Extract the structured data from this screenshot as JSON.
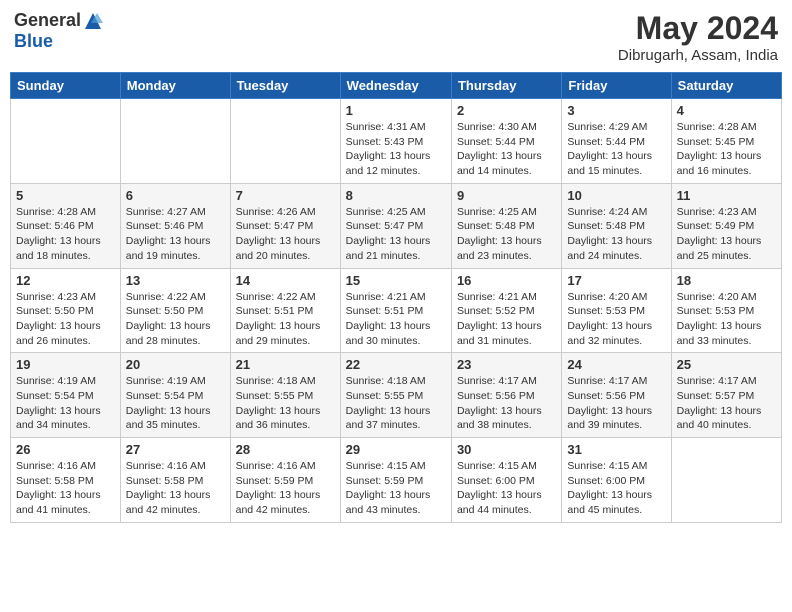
{
  "header": {
    "logo_general": "General",
    "logo_blue": "Blue",
    "month_year": "May 2024",
    "location": "Dibrugarh, Assam, India"
  },
  "weekdays": [
    "Sunday",
    "Monday",
    "Tuesday",
    "Wednesday",
    "Thursday",
    "Friday",
    "Saturday"
  ],
  "weeks": [
    [
      {
        "day": "",
        "info": ""
      },
      {
        "day": "",
        "info": ""
      },
      {
        "day": "",
        "info": ""
      },
      {
        "day": "1",
        "info": "Sunrise: 4:31 AM\nSunset: 5:43 PM\nDaylight: 13 hours\nand 12 minutes."
      },
      {
        "day": "2",
        "info": "Sunrise: 4:30 AM\nSunset: 5:44 PM\nDaylight: 13 hours\nand 14 minutes."
      },
      {
        "day": "3",
        "info": "Sunrise: 4:29 AM\nSunset: 5:44 PM\nDaylight: 13 hours\nand 15 minutes."
      },
      {
        "day": "4",
        "info": "Sunrise: 4:28 AM\nSunset: 5:45 PM\nDaylight: 13 hours\nand 16 minutes."
      }
    ],
    [
      {
        "day": "5",
        "info": "Sunrise: 4:28 AM\nSunset: 5:46 PM\nDaylight: 13 hours\nand 18 minutes."
      },
      {
        "day": "6",
        "info": "Sunrise: 4:27 AM\nSunset: 5:46 PM\nDaylight: 13 hours\nand 19 minutes."
      },
      {
        "day": "7",
        "info": "Sunrise: 4:26 AM\nSunset: 5:47 PM\nDaylight: 13 hours\nand 20 minutes."
      },
      {
        "day": "8",
        "info": "Sunrise: 4:25 AM\nSunset: 5:47 PM\nDaylight: 13 hours\nand 21 minutes."
      },
      {
        "day": "9",
        "info": "Sunrise: 4:25 AM\nSunset: 5:48 PM\nDaylight: 13 hours\nand 23 minutes."
      },
      {
        "day": "10",
        "info": "Sunrise: 4:24 AM\nSunset: 5:48 PM\nDaylight: 13 hours\nand 24 minutes."
      },
      {
        "day": "11",
        "info": "Sunrise: 4:23 AM\nSunset: 5:49 PM\nDaylight: 13 hours\nand 25 minutes."
      }
    ],
    [
      {
        "day": "12",
        "info": "Sunrise: 4:23 AM\nSunset: 5:50 PM\nDaylight: 13 hours\nand 26 minutes."
      },
      {
        "day": "13",
        "info": "Sunrise: 4:22 AM\nSunset: 5:50 PM\nDaylight: 13 hours\nand 28 minutes."
      },
      {
        "day": "14",
        "info": "Sunrise: 4:22 AM\nSunset: 5:51 PM\nDaylight: 13 hours\nand 29 minutes."
      },
      {
        "day": "15",
        "info": "Sunrise: 4:21 AM\nSunset: 5:51 PM\nDaylight: 13 hours\nand 30 minutes."
      },
      {
        "day": "16",
        "info": "Sunrise: 4:21 AM\nSunset: 5:52 PM\nDaylight: 13 hours\nand 31 minutes."
      },
      {
        "day": "17",
        "info": "Sunrise: 4:20 AM\nSunset: 5:53 PM\nDaylight: 13 hours\nand 32 minutes."
      },
      {
        "day": "18",
        "info": "Sunrise: 4:20 AM\nSunset: 5:53 PM\nDaylight: 13 hours\nand 33 minutes."
      }
    ],
    [
      {
        "day": "19",
        "info": "Sunrise: 4:19 AM\nSunset: 5:54 PM\nDaylight: 13 hours\nand 34 minutes."
      },
      {
        "day": "20",
        "info": "Sunrise: 4:19 AM\nSunset: 5:54 PM\nDaylight: 13 hours\nand 35 minutes."
      },
      {
        "day": "21",
        "info": "Sunrise: 4:18 AM\nSunset: 5:55 PM\nDaylight: 13 hours\nand 36 minutes."
      },
      {
        "day": "22",
        "info": "Sunrise: 4:18 AM\nSunset: 5:55 PM\nDaylight: 13 hours\nand 37 minutes."
      },
      {
        "day": "23",
        "info": "Sunrise: 4:17 AM\nSunset: 5:56 PM\nDaylight: 13 hours\nand 38 minutes."
      },
      {
        "day": "24",
        "info": "Sunrise: 4:17 AM\nSunset: 5:56 PM\nDaylight: 13 hours\nand 39 minutes."
      },
      {
        "day": "25",
        "info": "Sunrise: 4:17 AM\nSunset: 5:57 PM\nDaylight: 13 hours\nand 40 minutes."
      }
    ],
    [
      {
        "day": "26",
        "info": "Sunrise: 4:16 AM\nSunset: 5:58 PM\nDaylight: 13 hours\nand 41 minutes."
      },
      {
        "day": "27",
        "info": "Sunrise: 4:16 AM\nSunset: 5:58 PM\nDaylight: 13 hours\nand 42 minutes."
      },
      {
        "day": "28",
        "info": "Sunrise: 4:16 AM\nSunset: 5:59 PM\nDaylight: 13 hours\nand 42 minutes."
      },
      {
        "day": "29",
        "info": "Sunrise: 4:15 AM\nSunset: 5:59 PM\nDaylight: 13 hours\nand 43 minutes."
      },
      {
        "day": "30",
        "info": "Sunrise: 4:15 AM\nSunset: 6:00 PM\nDaylight: 13 hours\nand 44 minutes."
      },
      {
        "day": "31",
        "info": "Sunrise: 4:15 AM\nSunset: 6:00 PM\nDaylight: 13 hours\nand 45 minutes."
      },
      {
        "day": "",
        "info": ""
      }
    ]
  ]
}
